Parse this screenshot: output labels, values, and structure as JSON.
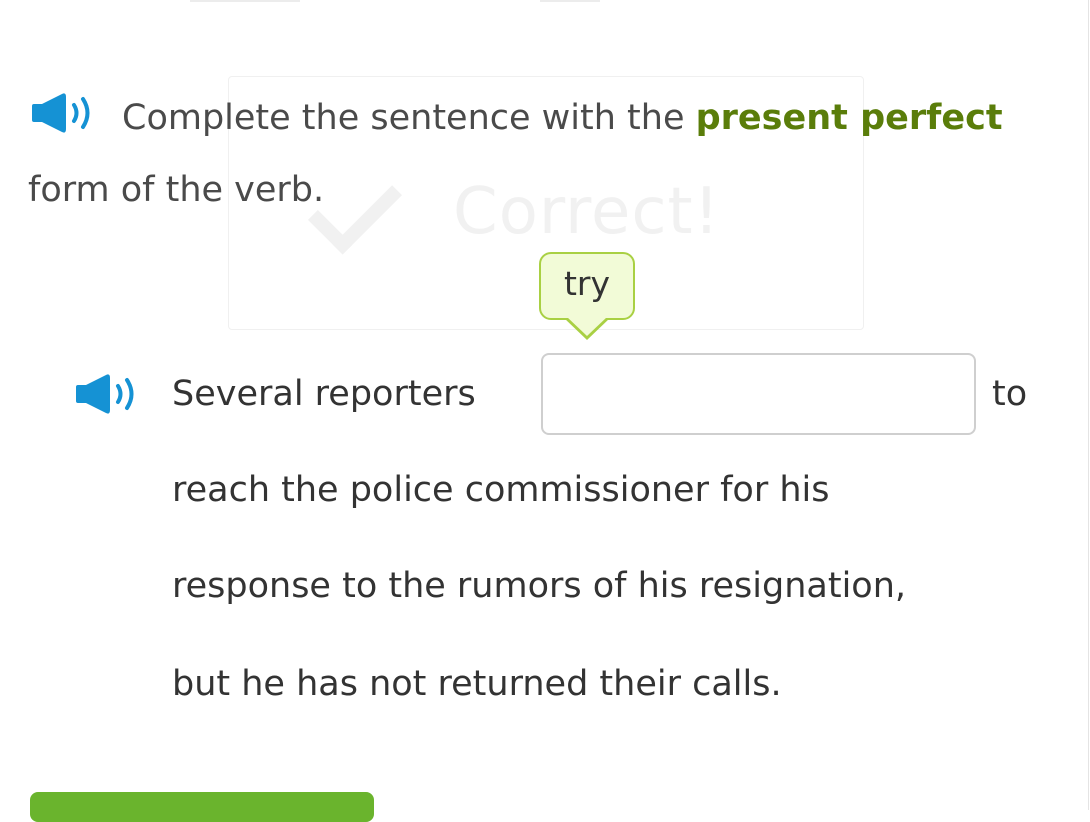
{
  "watermark": {
    "text": "Correct!"
  },
  "instruction": {
    "part1": "Complete the sentence with the ",
    "bold": "present perfect",
    "part2": " form of the verb."
  },
  "verb_chip": {
    "label": "try"
  },
  "sentence": {
    "before": "Several reporters",
    "after": "to",
    "line2": "reach the police commissioner for his",
    "line3": "response to the rumors of his resignation,",
    "line4": "but he has not returned their calls."
  },
  "answer_input": {
    "value": ""
  },
  "colors": {
    "speaker": "#1592d4",
    "keyword": "#5a7d0a",
    "chip_bg": "#f2fbd7",
    "chip_border": "#a9d043",
    "submit": "#6ab42d"
  }
}
